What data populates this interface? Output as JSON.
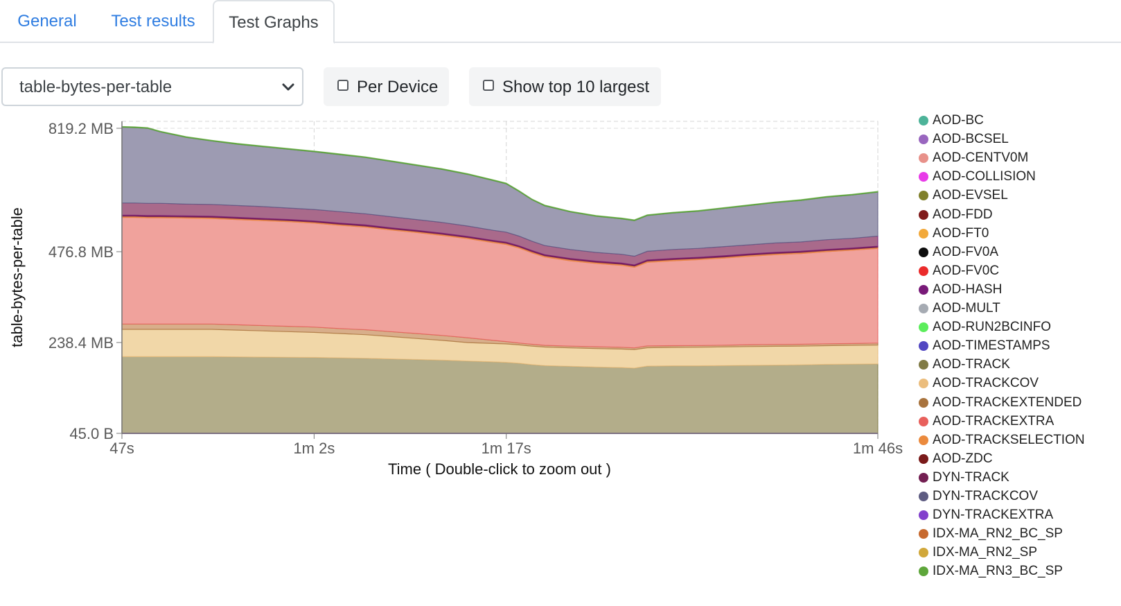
{
  "tabs": [
    {
      "label": "General",
      "active": false
    },
    {
      "label": "Test results",
      "active": false
    },
    {
      "label": "Test Graphs",
      "active": true
    }
  ],
  "controls": {
    "metric_select": {
      "value": "table-bytes-per-table"
    },
    "per_device": {
      "label": "Per Device",
      "checked": false
    },
    "top10": {
      "label": "Show top 10 largest",
      "checked": false
    }
  },
  "chart_data": {
    "type": "area",
    "stacked": true,
    "xlabel": "Time ( Double-click to zoom out )",
    "ylabel": "table-bytes-per-table",
    "yscale": "log",
    "y_ticks": [
      "819.2 MB",
      "476.8 MB",
      "238.4 MB",
      "45.0 B"
    ],
    "x_ticks": [
      "47s",
      "1m 2s",
      "1m 17s",
      "1m 46s"
    ],
    "x_tick_seconds": [
      47,
      62,
      77,
      106
    ],
    "xlim": [
      47,
      106
    ],
    "grid": true,
    "legend_position": "right",
    "x": [
      47,
      48,
      49,
      50,
      52,
      54,
      56,
      58,
      60,
      62,
      64,
      66,
      68,
      70,
      72,
      74,
      76,
      77,
      78,
      79,
      80,
      82,
      84,
      86,
      87,
      88,
      90,
      92,
      94,
      96,
      98,
      100,
      102,
      104,
      106
    ],
    "series_stack_totals_mb": [
      {
        "name": "AOD-TRACK (base)",
        "values": [
          155,
          155,
          155,
          155,
          155,
          155,
          154,
          153,
          152,
          151,
          149,
          147,
          144,
          141,
          138,
          134,
          130,
          128,
          124,
          118,
          114,
          111,
          108,
          106,
          104,
          112,
          113,
          113,
          114,
          115,
          116,
          117,
          119,
          120,
          121
        ]
      }
    ],
    "series": [
      {
        "name": "AOD-BC",
        "color": "#4db399"
      },
      {
        "name": "AOD-BCSEL",
        "color": "#9966bf"
      },
      {
        "name": "AOD-CENTV0M",
        "color": "#e8918a"
      },
      {
        "name": "AOD-COLLISION",
        "color": "#e83be8"
      },
      {
        "name": "AOD-EVSEL",
        "color": "#80802b"
      },
      {
        "name": "AOD-FDD",
        "color": "#801a1a"
      },
      {
        "name": "AOD-FT0",
        "color": "#f2a93b"
      },
      {
        "name": "AOD-FV0A",
        "color": "#0d0d0d"
      },
      {
        "name": "AOD-FV0C",
        "color": "#eb2b2b"
      },
      {
        "name": "AOD-HASH",
        "color": "#781a78"
      },
      {
        "name": "AOD-MULT",
        "color": "#a6abb3"
      },
      {
        "name": "AOD-RUN2BCINFO",
        "color": "#5ced5c"
      },
      {
        "name": "AOD-TIMESTAMPS",
        "color": "#5247c2"
      },
      {
        "name": "AOD-TRACK",
        "color": "#807a45"
      },
      {
        "name": "AOD-TRACKCOV",
        "color": "#ebbd7d"
      },
      {
        "name": "AOD-TRACKEXTENDED",
        "color": "#a8733d"
      },
      {
        "name": "AOD-TRACKEXTRA",
        "color": "#e8605c"
      },
      {
        "name": "AOD-TRACKSELECTION",
        "color": "#eb8a3d"
      },
      {
        "name": "AOD-ZDC",
        "color": "#7a1a1a"
      },
      {
        "name": "DYN-TRACK",
        "color": "#731f52"
      },
      {
        "name": "DYN-TRACKCOV",
        "color": "#5e5c82"
      },
      {
        "name": "DYN-TRACKEXTRA",
        "color": "#8240cc"
      },
      {
        "name": "IDX-MA_RN2_BC_SP",
        "color": "#c7692e"
      },
      {
        "name": "IDX-MA_RN2_SP",
        "color": "#d1a83b"
      },
      {
        "name": "IDX-MA_RN3_BC_SP",
        "color": "#5ea63b"
      }
    ],
    "bands_mb": {
      "AOD-TRACK": [
        155,
        155,
        155,
        155,
        155,
        155,
        154,
        153,
        152,
        151,
        149,
        147,
        144,
        141,
        138,
        134,
        130,
        128,
        124,
        118,
        114,
        111,
        108,
        106,
        104,
        112,
        113,
        113,
        114,
        115,
        116,
        117,
        119,
        120,
        121
      ],
      "AOD-TRACKCOV": [
        118,
        118,
        118,
        118,
        118,
        118,
        117,
        116,
        115,
        114,
        113,
        112,
        110,
        108,
        106,
        104,
        102,
        101,
        99,
        97,
        95,
        93,
        92,
        91,
        90,
        93,
        94,
        95,
        96,
        97,
        98,
        98,
        99,
        100,
        101
      ],
      "AOD-TRACKEXTENDED": [
        14,
        14,
        14,
        14,
        14,
        14,
        14,
        14,
        14,
        14,
        13,
        13,
        13,
        13,
        13,
        13,
        12,
        12,
        12,
        12,
        11,
        11,
        11,
        11,
        10,
        11,
        11,
        11,
        11,
        12,
        12,
        12,
        12,
        12,
        13
      ],
      "AOD-TRACKEXTRA": [
        285,
        285,
        284,
        284,
        283,
        282,
        281,
        280,
        279,
        277,
        275,
        273,
        270,
        268,
        265,
        262,
        258,
        256,
        252,
        247,
        243,
        238,
        235,
        233,
        232,
        233,
        235,
        237,
        239,
        241,
        243,
        245,
        247,
        249,
        251
      ],
      "AOD-TRACKSELECTION": [
        3,
        3,
        3,
        3,
        3,
        3,
        3,
        3,
        3,
        3,
        3,
        3,
        3,
        3,
        3,
        3,
        3,
        3,
        3,
        3,
        3,
        3,
        3,
        3,
        3,
        3,
        3,
        3,
        3,
        3,
        3,
        3,
        3,
        3,
        3
      ],
      "DYN-TRACK": [
        3,
        3,
        3,
        3,
        3,
        3,
        3,
        3,
        3,
        3,
        3,
        3,
        3,
        3,
        3,
        3,
        3,
        3,
        3,
        3,
        3,
        3,
        3,
        3,
        3,
        3,
        3,
        3,
        3,
        3,
        3,
        3,
        3,
        3,
        3
      ],
      "AOD-HASH": [
        34,
        34,
        34,
        34,
        33,
        33,
        33,
        33,
        32,
        32,
        32,
        31,
        31,
        30,
        30,
        29,
        28,
        28,
        27,
        26,
        25,
        24,
        23,
        23,
        23,
        23,
        24,
        24,
        25,
        25,
        26,
        26,
        27,
        27,
        28
      ],
      "DYN-TRACKCOV": [
        210,
        209,
        208,
        198,
        185,
        176,
        170,
        166,
        163,
        160,
        158,
        156,
        153,
        150,
        147,
        143,
        138,
        134,
        124,
        115,
        110,
        104,
        100,
        98,
        98,
        99,
        101,
        103,
        106,
        109,
        112,
        115,
        118,
        120,
        122
      ],
      "IDX-MA_RN3_BC_SP": [
        2,
        2,
        2,
        2,
        2,
        2,
        2,
        2,
        2,
        2,
        2,
        2,
        2,
        2,
        2,
        2,
        2,
        2,
        2,
        2,
        2,
        2,
        2,
        2,
        2,
        2,
        2,
        2,
        2,
        2,
        2,
        2,
        2,
        2,
        2
      ]
    }
  }
}
